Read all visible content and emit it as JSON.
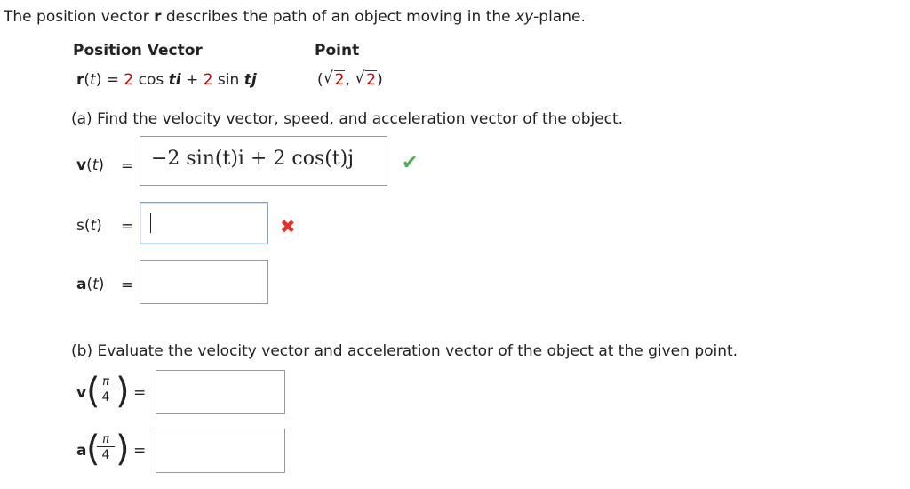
{
  "intro": {
    "part1": "The position vector ",
    "r": "r",
    "part2": " describes the path of an object moving in the ",
    "xy": "xy",
    "part3": "-plane."
  },
  "table": {
    "col1_header": "Position Vector",
    "col2_header": "Point",
    "r_label": "r",
    "t": "t",
    "eq": "=",
    "coef1": "2",
    "cos_text": "cos ",
    "coef2": "2",
    "sin_text": "sin ",
    "i": "i",
    "j": "j",
    "plus": "+",
    "point_open": "(",
    "point_comma": ", ",
    "point_close": ")",
    "point_sqrt1": "2",
    "point_sqrt2": "2"
  },
  "part_a": {
    "prompt": "(a) Find the velocity vector, speed, and acceleration vector of the object.",
    "v_label": "v",
    "s_label": "s",
    "a_label": "a",
    "t": "t",
    "equals": "=",
    "v_answer": "−2 sin(t)i + 2 cos(t)j",
    "s_answer": "",
    "a_answer": "",
    "correct_mark": "✔",
    "incorrect_mark": "✖"
  },
  "part_b": {
    "prompt": "(b) Evaluate the velocity vector and acceleration vector of the object at the given point.",
    "v_label": "v",
    "a_label": "a",
    "frac_num": "π",
    "frac_den": "4",
    "equals": "=",
    "v_answer": "",
    "a_answer": ""
  },
  "colors": {
    "accent_red": "#c40000",
    "correct_green": "#4caf50",
    "incorrect_red": "#e0322f"
  }
}
